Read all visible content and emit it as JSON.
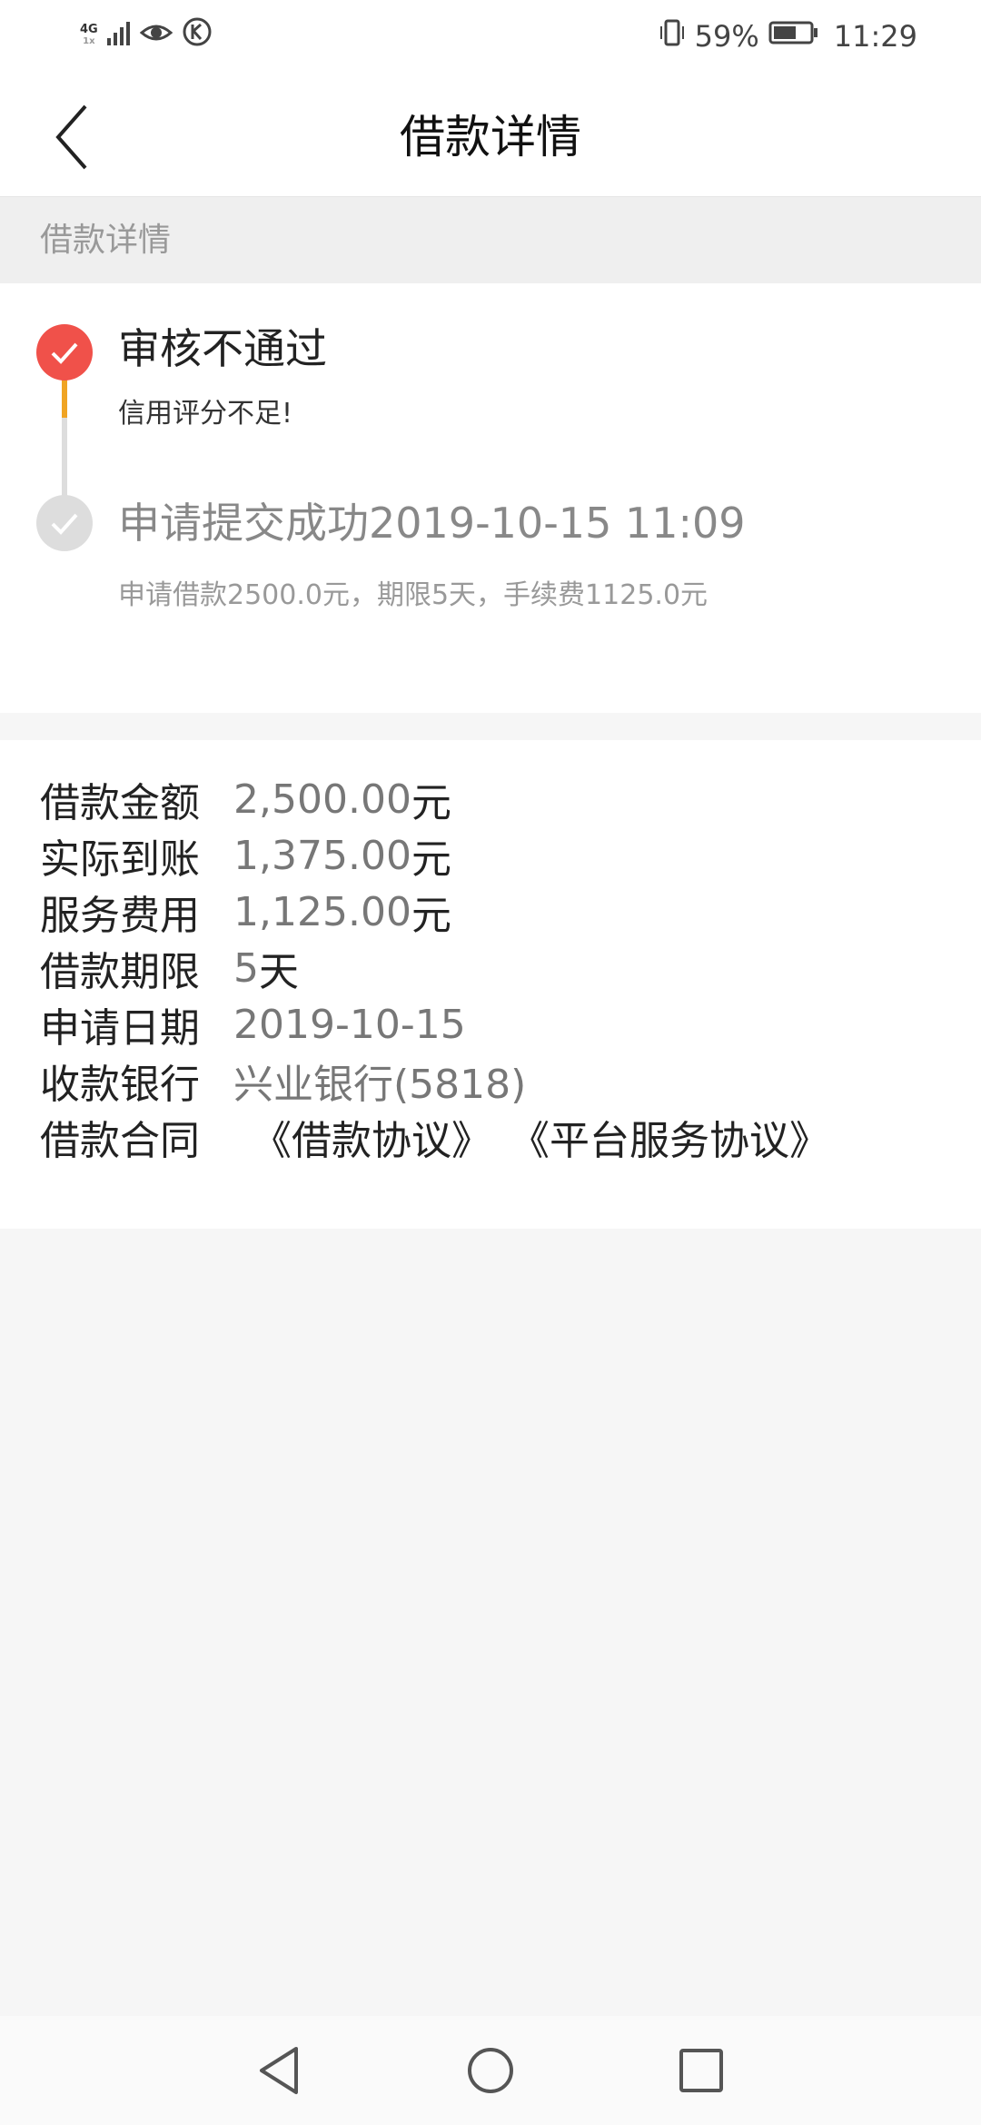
{
  "status_bar": {
    "network_top": "4G",
    "network_bottom": "1x",
    "battery_percent": "59%",
    "time": "11:29",
    "icons": [
      "signal-icon",
      "eye-icon",
      "k-app-icon",
      "vibrate-icon",
      "battery-icon"
    ]
  },
  "header": {
    "title": "借款详情",
    "back_icon": "chevron-left-icon"
  },
  "section": {
    "title": "借款详情"
  },
  "timeline": [
    {
      "title": "审核不通过",
      "subtitle": "信用评分不足!",
      "status": "rejected",
      "dot_color": "#f0514a",
      "line_color": "#f0a423"
    },
    {
      "title": "申请提交成功2019-10-15 11:09",
      "subtitle": "申请借款2500.0元，期限5天，手续费1125.0元",
      "status": "submitted",
      "dot_color": "#dddddd"
    }
  ],
  "details": {
    "loan_amount": {
      "label": "借款金额",
      "value": "2,500.00",
      "unit": "元"
    },
    "actual_received": {
      "label": "实际到账",
      "value": "1,375.00",
      "unit": "元"
    },
    "service_fee": {
      "label": "服务费用",
      "value": "1,125.00",
      "unit": "元"
    },
    "term": {
      "label": "借款期限",
      "value": "5",
      "unit": "天"
    },
    "apply_date": {
      "label": "申请日期",
      "value": "2019-10-15"
    },
    "bank": {
      "label": "收款银行",
      "value": "兴业银行(5818)"
    },
    "contract": {
      "label": "借款合同",
      "links": [
        "《借款协议》",
        "《平台服务协议》"
      ]
    }
  },
  "nav_bar": {
    "icons": [
      "back-triangle-icon",
      "home-circle-icon",
      "recents-square-icon"
    ]
  }
}
